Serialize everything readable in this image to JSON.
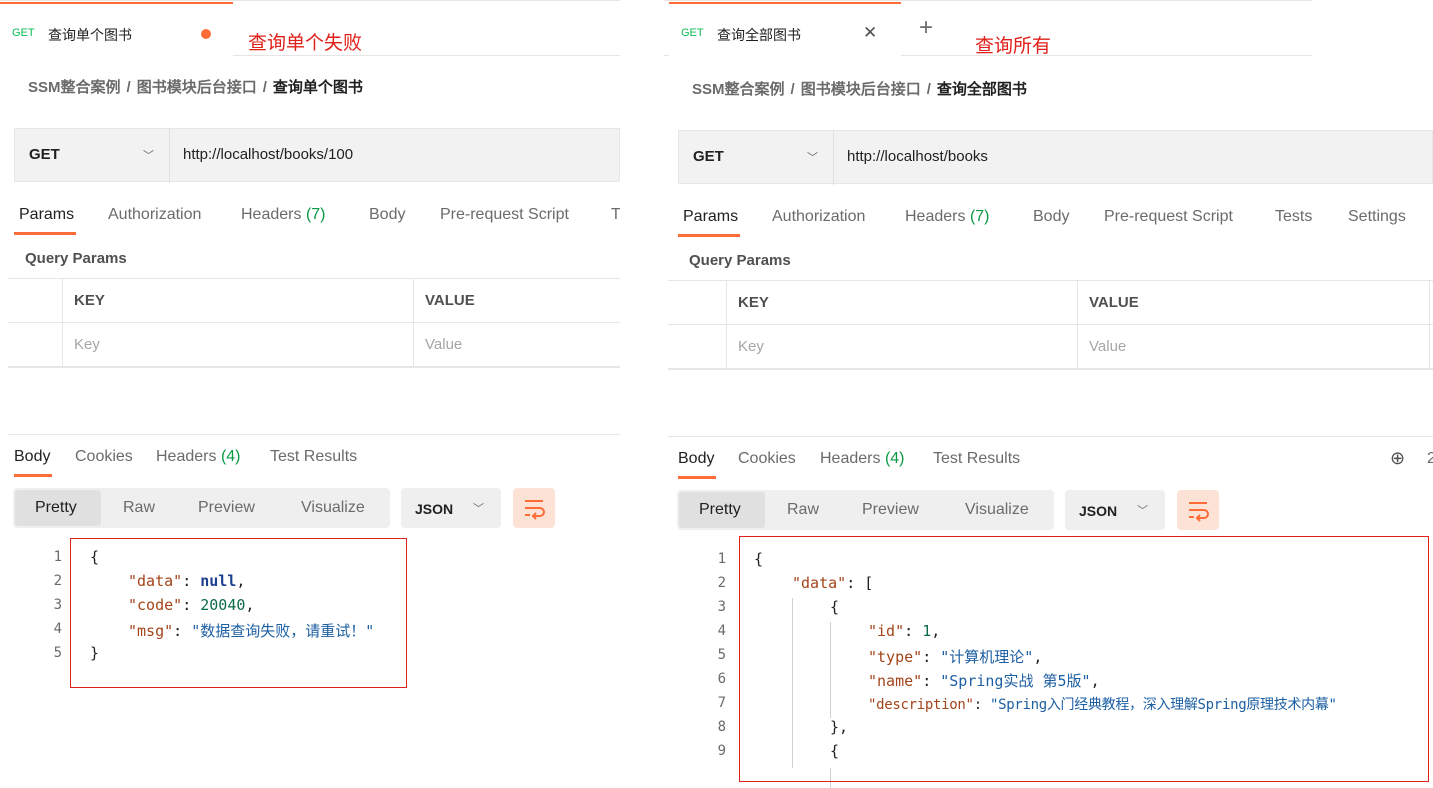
{
  "left": {
    "tab": {
      "method": "GET",
      "name": "查询单个图书"
    },
    "annotation": "查询单个失败",
    "breadcrumb": {
      "collection": "SSM整合案例",
      "folder": "图书模块后台接口",
      "request": "查询单个图书",
      "separator": "/"
    },
    "request": {
      "method": "GET",
      "url": "http://localhost/books/100"
    },
    "request_tabs": {
      "params": "Params",
      "authorization": "Authorization",
      "headers": "Headers",
      "headers_count": "(7)",
      "body": "Body",
      "prerequest": "Pre-request Script",
      "tests_cut": "T"
    },
    "query_params": {
      "title": "Query Params",
      "key_header": "KEY",
      "value_header": "VALUE",
      "key_placeholder": "Key",
      "value_placeholder": "Value"
    },
    "response_tabs": {
      "body": "Body",
      "cookies": "Cookies",
      "headers": "Headers",
      "headers_count": "(4)",
      "test_results": "Test Results"
    },
    "view_modes": {
      "pretty": "Pretty",
      "raw": "Raw",
      "preview": "Preview",
      "visualize": "Visualize"
    },
    "format": "JSON",
    "code_lines": [
      {
        "num": "1",
        "text": "{"
      },
      {
        "num": "2",
        "key": "\"data\"",
        "value": "null",
        "type": "kw",
        "trail": ","
      },
      {
        "num": "3",
        "key": "\"code\"",
        "value": "20040",
        "type": "num",
        "trail": ","
      },
      {
        "num": "4",
        "key": "\"msg\"",
        "value": "\"数据查询失败，请重试！\"",
        "type": "str",
        "trail": ""
      },
      {
        "num": "5",
        "text": "}"
      }
    ]
  },
  "right": {
    "tab": {
      "method": "GET",
      "name": "查询全部图书",
      "close": "✕",
      "add": "+"
    },
    "annotation": "查询所有",
    "breadcrumb": {
      "collection": "SSM整合案例",
      "folder": "图书模块后台接口",
      "request": "查询全部图书",
      "separator": "/"
    },
    "request": {
      "method": "GET",
      "url": "http://localhost/books"
    },
    "request_tabs": {
      "params": "Params",
      "authorization": "Authorization",
      "headers": "Headers",
      "headers_count": "(7)",
      "body": "Body",
      "prerequest": "Pre-request Script",
      "tests": "Tests",
      "settings": "Settings"
    },
    "query_params": {
      "title": "Query Params",
      "key_header": "KEY",
      "value_header": "VALUE",
      "key_placeholder": "Key",
      "value_placeholder": "Value"
    },
    "response_tabs": {
      "body": "Body",
      "cookies": "Cookies",
      "headers": "Headers",
      "headers_count": "(4)",
      "test_results": "Test Results",
      "cut_text": "2"
    },
    "view_modes": {
      "pretty": "Pretty",
      "raw": "Raw",
      "preview": "Preview",
      "visualize": "Visualize"
    },
    "format": "JSON",
    "code_lines": [
      {
        "num": "1",
        "text": "{"
      },
      {
        "num": "2",
        "key": "\"data\"",
        "value": "[",
        "type": "punct",
        "trail": ""
      },
      {
        "num": "3",
        "text": "{"
      },
      {
        "num": "4",
        "key": "\"id\"",
        "value": "1",
        "type": "num",
        "trail": ","
      },
      {
        "num": "5",
        "key": "\"type\"",
        "value": "\"计算机理论\"",
        "type": "str",
        "trail": ","
      },
      {
        "num": "6",
        "key": "\"name\"",
        "value": "\"Spring实战 第5版\"",
        "type": "str",
        "trail": ","
      },
      {
        "num": "7",
        "key": "\"description\"",
        "value": "\"Spring入门经典教程，深入理解Spring原理技术内幕\"",
        "type": "str",
        "trail": ""
      },
      {
        "num": "8",
        "text": "},"
      },
      {
        "num": "9",
        "text": "{"
      }
    ]
  },
  "colors": {
    "accent": "#ff6c37",
    "annotation_red": "#e0201a",
    "method_green": "#0cbb52",
    "count_green": "#0a9a44"
  }
}
